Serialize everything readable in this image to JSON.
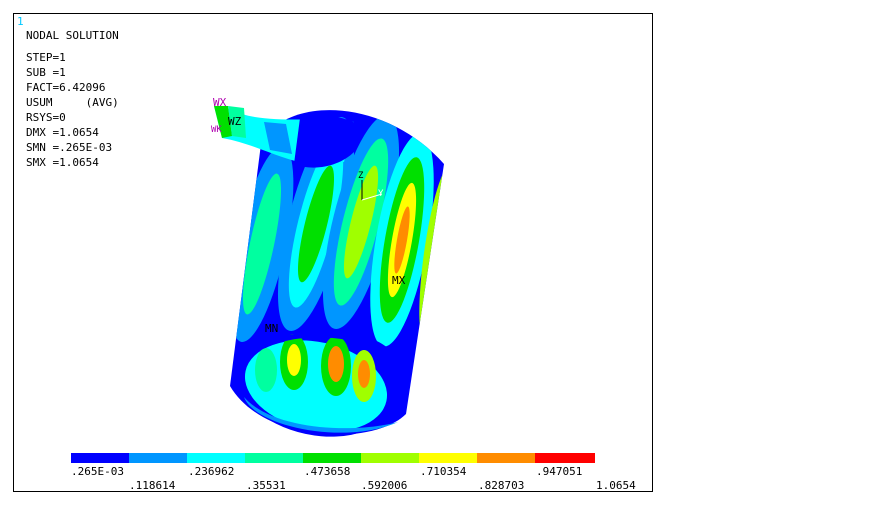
{
  "window_number": "1",
  "info": {
    "title": "NODAL SOLUTION",
    "lines": [
      "STEP=1",
      "SUB =1",
      "FACT=6.42096",
      "USUM     (AVG)",
      "RSYS=0",
      "DMX =1.0654",
      "SMN =.265E-03",
      "SMX =1.0654"
    ]
  },
  "markers": {
    "mx": "MX",
    "mn": "MN",
    "wx": "WX",
    "wz": "WZ",
    "wk": "WK",
    "z": "Z",
    "y": "Y"
  },
  "legend": {
    "colors": [
      "#0000ff",
      "#0096ff",
      "#00ffff",
      "#00ffa0",
      "#00e000",
      "#a0ff00",
      "#ffff00",
      "#ff8c00",
      "#ff0000"
    ],
    "labels_top": [
      ".265E-03",
      ".236962",
      ".473658",
      ".710354",
      ".947051"
    ],
    "labels_bottom": [
      ".118614",
      ".35531",
      ".592006",
      ".828703",
      "1.0654"
    ]
  }
}
